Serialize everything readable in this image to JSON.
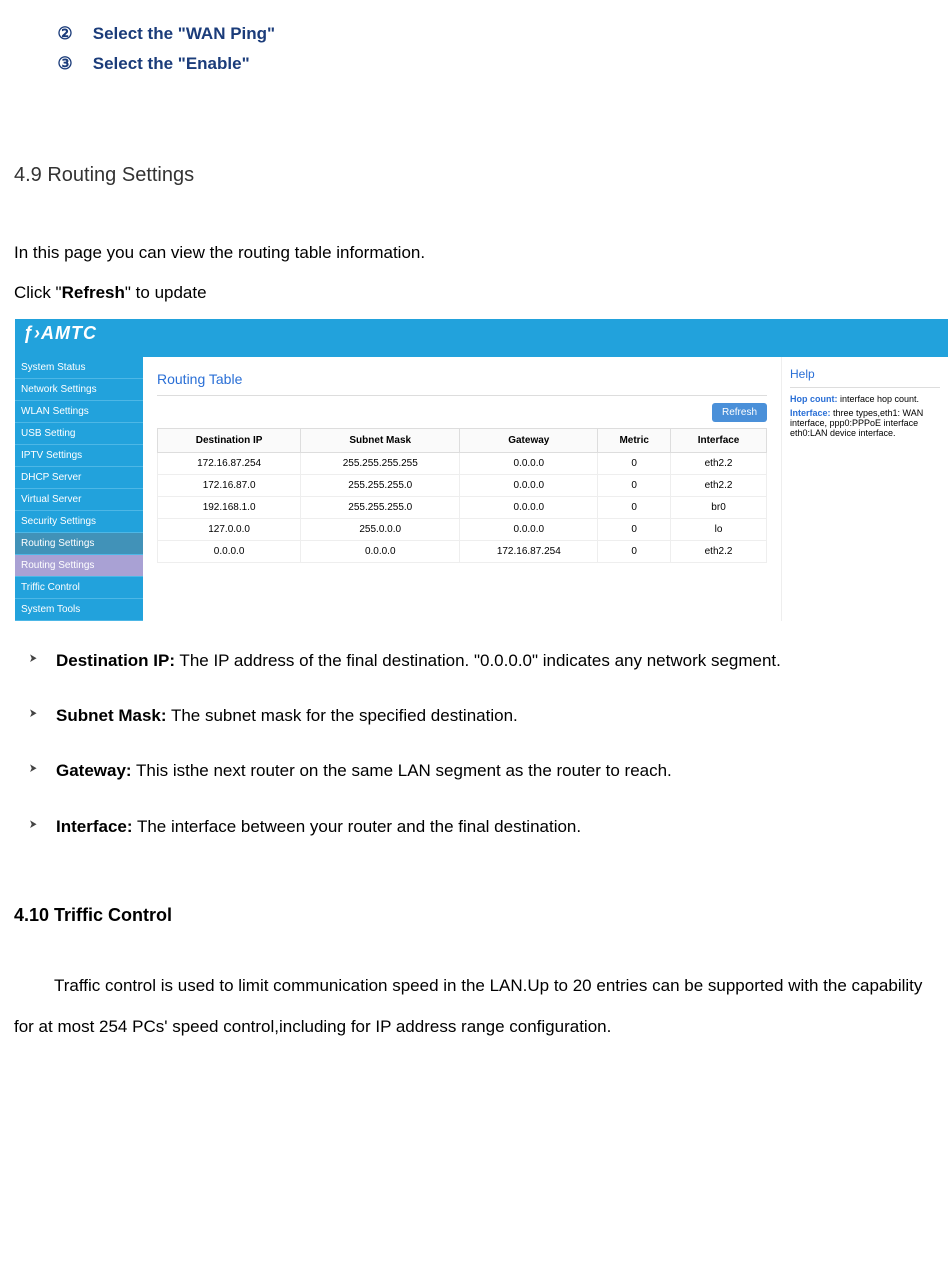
{
  "steps": {
    "s2_num": "②",
    "s2_text": "Select the \"WAN Ping\"",
    "s3_num": "③",
    "s3_text": "Select the \"Enable\""
  },
  "section49_title": "4.9 Routing Settings",
  "section49_intro1": "In this page you can view the routing table information.",
  "section49_intro2a": "Click \"",
  "section49_intro2b": "Refresh",
  "section49_intro2c": "\" to update",
  "ui": {
    "logo": "ƒ›AMTC",
    "sidebar": {
      "items": [
        {
          "label": "System Status",
          "cls": ""
        },
        {
          "label": "Network Settings",
          "cls": ""
        },
        {
          "label": "WLAN Settings",
          "cls": ""
        },
        {
          "label": "USB Setting",
          "cls": ""
        },
        {
          "label": "IPTV Settings",
          "cls": ""
        },
        {
          "label": "DHCP Server",
          "cls": ""
        },
        {
          "label": "Virtual Server",
          "cls": ""
        },
        {
          "label": "Security Settings",
          "cls": ""
        },
        {
          "label": "Routing Settings",
          "cls": "dark"
        },
        {
          "label": "Routing Settings",
          "cls": "active"
        },
        {
          "label": "Triffic Control",
          "cls": ""
        },
        {
          "label": "System Tools",
          "cls": ""
        }
      ]
    },
    "panel_title": "Routing Table",
    "refresh_label": "Refresh",
    "table": {
      "headers": [
        "Destination IP",
        "Subnet Mask",
        "Gateway",
        "Metric",
        "Interface"
      ],
      "rows": [
        [
          "172.16.87.254",
          "255.255.255.255",
          "0.0.0.0",
          "0",
          "eth2.2"
        ],
        [
          "172.16.87.0",
          "255.255.255.0",
          "0.0.0.0",
          "0",
          "eth2.2"
        ],
        [
          "192.168.1.0",
          "255.255.255.0",
          "0.0.0.0",
          "0",
          "br0"
        ],
        [
          "127.0.0.0",
          "255.0.0.0",
          "0.0.0.0",
          "0",
          "lo"
        ],
        [
          "0.0.0.0",
          "0.0.0.0",
          "172.16.87.254",
          "0",
          "eth2.2"
        ]
      ]
    },
    "help": {
      "title": "Help",
      "hop_label": "Hop count:",
      "hop_text": " interface hop count.",
      "iface_label": "Interface:",
      "iface_text": " three types,eth1: WAN interface, ppp0:PPPoE interface eth0:LAN device interface."
    }
  },
  "definitions": [
    {
      "term": "Destination IP:",
      "text": " The IP address of the final destination. \"0.0.0.0\" indicates any network segment."
    },
    {
      "term": "Subnet Mask:",
      "text": " The subnet mask for the specified destination."
    },
    {
      "term": "Gateway:",
      "text": " This isthe next router on the same LAN segment as the router to reach."
    },
    {
      "term": "Interface:",
      "text": " The interface between your router and the final destination."
    }
  ],
  "section410_title": "4.10 Triffic Control",
  "section410_body": "Traffic control is used to limit communication speed in the LAN.Up to 20 entries can be supported with the capability for at most 254 PCs' speed control,including for IP address range configuration."
}
